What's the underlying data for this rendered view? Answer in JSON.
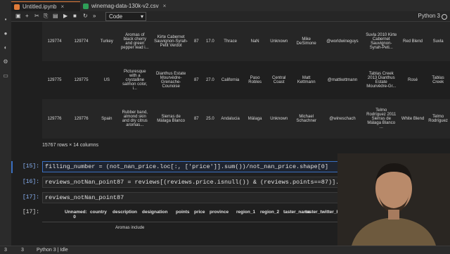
{
  "tabs": [
    {
      "label": "Untitled.ipynb",
      "close": "×"
    },
    {
      "label": "winemag-data-130k-v2.csv",
      "close": "×"
    }
  ],
  "toolbar": {
    "cell_type": "Code",
    "kernel": "Python 3"
  },
  "df_rows": [
    {
      "idx": "129774",
      "unnamed": "129774",
      "country": "Turkey",
      "description": "Aromas of black cherry and green pepper lead i...",
      "designation": "Kirte Cabernet Sauvignon-Syrah-Petit Verdot",
      "points": "87",
      "price": "17.0",
      "province": "Thrace",
      "region_1": "NaN",
      "region_2": "Unknown",
      "taster_name": "Mike DeSimone",
      "twitter": "@worldwineguys",
      "title": "Suvla 2010 Kirte Cabernet Sauvignon-Syrah-Peti...",
      "variety": "Red Blend",
      "winery": "Suvla"
    },
    {
      "idx": "129775",
      "unnamed": "129775",
      "country": "US",
      "description": "Picturesque with a crystalline salmon color, i...",
      "designation": "Dianthus Estate Mourvèdre-Grenache-Counoise",
      "points": "87",
      "price": "27.0",
      "province": "California",
      "region_1": "Paso Robles",
      "region_2": "Central Coast",
      "taster_name": "Matt Kettmann",
      "twitter": "@mattkettmann",
      "title": "Tablas Creek 2013 Dianthus Estate Mourvèdre-Gr...",
      "variety": "Rosé",
      "winery": "Tablas Creek"
    },
    {
      "idx": "129776",
      "unnamed": "129776",
      "country": "Spain",
      "description": "Rubber band, almond skin and dry citrus aromas...",
      "designation": "Sierras de Málaga Blanco",
      "points": "87",
      "price": "25.0",
      "province": "Andalucia",
      "region_1": "Málaga",
      "region_2": "Unknown",
      "taster_name": "Michael Schachner",
      "twitter": "@wineschach",
      "title": "Telmo Rodríguez 2011 Sierras de Málaga Blanco ...",
      "variety": "White Blend",
      "winery": "Telmo Rodríguez"
    }
  ],
  "shape_text": "15767 rows × 14 columns",
  "cells": [
    {
      "prompt": "[15]:",
      "code": "filling_number = (not_nan_price.loc[:, ['price']].sum())/not_nan_price.shape[0]"
    },
    {
      "prompt": "[16]:",
      "code": "reviews_notNan_point87 = reviews[(reviews.price.isnull()) & (reviews.points==87)].fillna(int(filling"
    },
    {
      "prompt": "[17]:",
      "code": "reviews_notNan_point87"
    }
  ],
  "out_prompt": "[17]:",
  "headers": [
    "Unnamed: 0",
    "country",
    "description",
    "designation",
    "points",
    "price",
    "province",
    "region_1",
    "region_2",
    "taster_name",
    "taster_twitter_handle",
    "title",
    "winery"
  ],
  "partial_row": {
    "description": "Aromas include"
  },
  "statusbar": {
    "left": "3",
    "mid": "3",
    "kernel": "Python 3 | Idle"
  }
}
